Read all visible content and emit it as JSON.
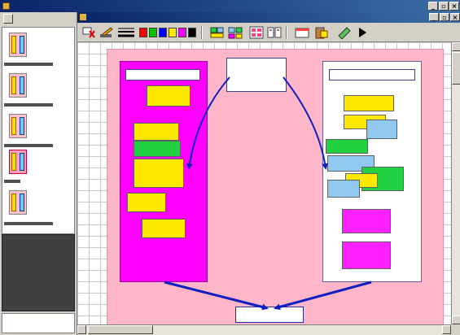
{
  "app": {
    "title": "",
    "title_icon": "app-logo-icon",
    "window_buttons": [
      "minimize-icon",
      "restore-icon",
      "close-icon"
    ]
  },
  "document": {
    "title": "",
    "window_buttons": [
      "minimize-icon",
      "restore-icon",
      "close-icon"
    ]
  },
  "sidebar": {
    "slides": [
      {
        "label": "",
        "selected": false
      },
      {
        "label": "",
        "selected": false
      },
      {
        "label": "",
        "selected": false
      },
      {
        "label": "",
        "selected": true
      },
      {
        "label": "",
        "selected": false
      },
      {
        "label": "",
        "selected": false
      }
    ],
    "bottom_field": ""
  },
  "toolbar": {
    "tools": [
      "eraser-icon",
      "pen-icon",
      "line-width-icon",
      "color-swatches",
      "group-icon",
      "ungroup-icon",
      "grid-icon",
      "align-icon",
      "card-icon",
      "clipboard-icon",
      "wand-icon",
      "play-icon"
    ],
    "swatch_colors": [
      "#ff0000",
      "#00c000",
      "#0000ff",
      "#ffe800",
      "#ff00ff",
      "#000000"
    ]
  },
  "board": {
    "left_header": "",
    "right_header": "",
    "center_question": "",
    "bottom_box": "",
    "left_notes": [
      {
        "text": "",
        "color": "yellow"
      },
      {
        "text": "",
        "color": "yellow"
      },
      {
        "text": "",
        "color": "green"
      },
      {
        "text": "",
        "color": "yellow"
      },
      {
        "text": "",
        "color": "yellow"
      },
      {
        "text": "",
        "color": "yellow"
      }
    ],
    "right_notes": [
      {
        "text": "",
        "color": "yellow"
      },
      {
        "text": "",
        "color": "yellow"
      },
      {
        "text": "",
        "color": "blue"
      },
      {
        "text": "",
        "color": "green"
      },
      {
        "text": "",
        "color": "blue"
      },
      {
        "text": "",
        "color": "green"
      },
      {
        "text": "",
        "color": "yellow"
      },
      {
        "text": "",
        "color": "blue"
      },
      {
        "text": "",
        "color": "magenta"
      },
      {
        "text": "",
        "color": "magenta"
      }
    ],
    "colors": {
      "page": "#ffb6c8",
      "left_column": "#ff00ff",
      "arrow": "#1020c0"
    }
  }
}
